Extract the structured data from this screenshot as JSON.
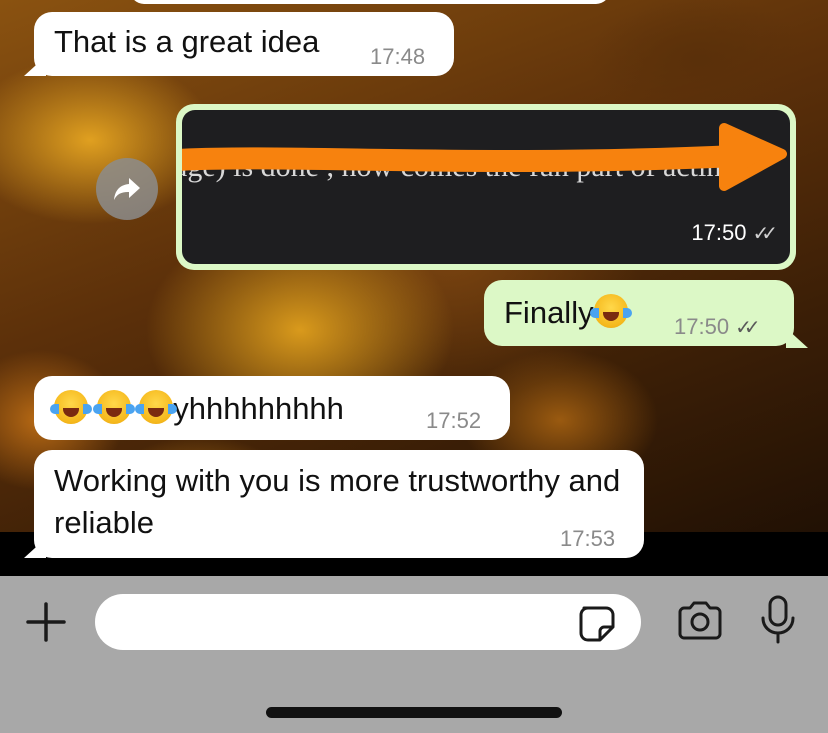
{
  "messages": [
    {
      "id": "m1",
      "direction": "incoming",
      "text": "That is a great idea",
      "time": "17:48"
    },
    {
      "id": "m2",
      "direction": "outgoing",
      "type": "image",
      "image_text": "age) is done , now comes the fun part of acting",
      "time": "17:50",
      "status": "read"
    },
    {
      "id": "m3",
      "direction": "outgoing",
      "text": "Finally",
      "emoji": "face-with-tears-of-joy",
      "time": "17:50",
      "status": "read"
    },
    {
      "id": "m4",
      "direction": "incoming",
      "emoji_count": 3,
      "text": "yhhhhhhhhh",
      "time": "17:52"
    },
    {
      "id": "m5",
      "direction": "incoming",
      "text": "Working with you is more trustworthy and reliable",
      "time": "17:53"
    }
  ],
  "ticks_glyph": "✓✓",
  "composer": {
    "placeholder": "",
    "value": ""
  },
  "icons": {
    "forward": "forward-arrow-icon",
    "attach": "plus-icon",
    "sticker": "sticker-icon",
    "camera": "camera-icon",
    "mic": "microphone-icon"
  },
  "colors": {
    "incoming_bubble": "#ffffff",
    "outgoing_bubble": "#dcf8c6",
    "annotation_arrow": "#f7820e",
    "input_bar": "#a8a8a8"
  }
}
